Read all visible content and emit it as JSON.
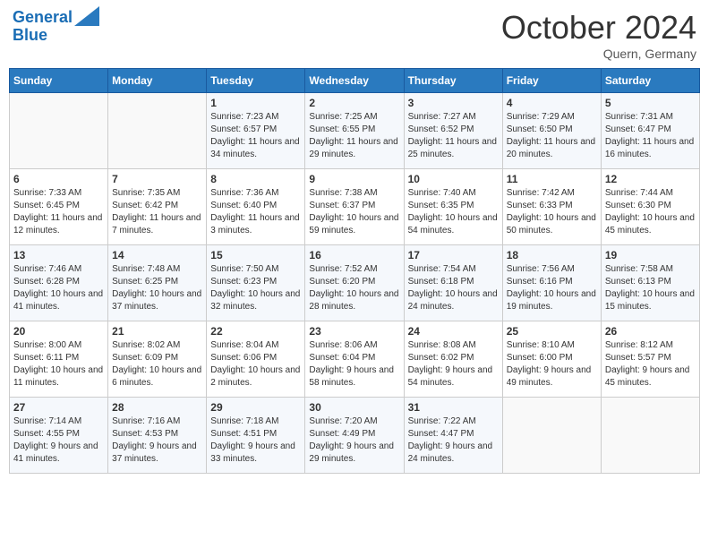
{
  "header": {
    "logo_line1": "General",
    "logo_line2": "Blue",
    "month": "October 2024",
    "location": "Quern, Germany"
  },
  "weekdays": [
    "Sunday",
    "Monday",
    "Tuesday",
    "Wednesday",
    "Thursday",
    "Friday",
    "Saturday"
  ],
  "weeks": [
    [
      {
        "day": "",
        "info": ""
      },
      {
        "day": "",
        "info": ""
      },
      {
        "day": "1",
        "info": "Sunrise: 7:23 AM\nSunset: 6:57 PM\nDaylight: 11 hours and 34 minutes."
      },
      {
        "day": "2",
        "info": "Sunrise: 7:25 AM\nSunset: 6:55 PM\nDaylight: 11 hours and 29 minutes."
      },
      {
        "day": "3",
        "info": "Sunrise: 7:27 AM\nSunset: 6:52 PM\nDaylight: 11 hours and 25 minutes."
      },
      {
        "day": "4",
        "info": "Sunrise: 7:29 AM\nSunset: 6:50 PM\nDaylight: 11 hours and 20 minutes."
      },
      {
        "day": "5",
        "info": "Sunrise: 7:31 AM\nSunset: 6:47 PM\nDaylight: 11 hours and 16 minutes."
      }
    ],
    [
      {
        "day": "6",
        "info": "Sunrise: 7:33 AM\nSunset: 6:45 PM\nDaylight: 11 hours and 12 minutes."
      },
      {
        "day": "7",
        "info": "Sunrise: 7:35 AM\nSunset: 6:42 PM\nDaylight: 11 hours and 7 minutes."
      },
      {
        "day": "8",
        "info": "Sunrise: 7:36 AM\nSunset: 6:40 PM\nDaylight: 11 hours and 3 minutes."
      },
      {
        "day": "9",
        "info": "Sunrise: 7:38 AM\nSunset: 6:37 PM\nDaylight: 10 hours and 59 minutes."
      },
      {
        "day": "10",
        "info": "Sunrise: 7:40 AM\nSunset: 6:35 PM\nDaylight: 10 hours and 54 minutes."
      },
      {
        "day": "11",
        "info": "Sunrise: 7:42 AM\nSunset: 6:33 PM\nDaylight: 10 hours and 50 minutes."
      },
      {
        "day": "12",
        "info": "Sunrise: 7:44 AM\nSunset: 6:30 PM\nDaylight: 10 hours and 45 minutes."
      }
    ],
    [
      {
        "day": "13",
        "info": "Sunrise: 7:46 AM\nSunset: 6:28 PM\nDaylight: 10 hours and 41 minutes."
      },
      {
        "day": "14",
        "info": "Sunrise: 7:48 AM\nSunset: 6:25 PM\nDaylight: 10 hours and 37 minutes."
      },
      {
        "day": "15",
        "info": "Sunrise: 7:50 AM\nSunset: 6:23 PM\nDaylight: 10 hours and 32 minutes."
      },
      {
        "day": "16",
        "info": "Sunrise: 7:52 AM\nSunset: 6:20 PM\nDaylight: 10 hours and 28 minutes."
      },
      {
        "day": "17",
        "info": "Sunrise: 7:54 AM\nSunset: 6:18 PM\nDaylight: 10 hours and 24 minutes."
      },
      {
        "day": "18",
        "info": "Sunrise: 7:56 AM\nSunset: 6:16 PM\nDaylight: 10 hours and 19 minutes."
      },
      {
        "day": "19",
        "info": "Sunrise: 7:58 AM\nSunset: 6:13 PM\nDaylight: 10 hours and 15 minutes."
      }
    ],
    [
      {
        "day": "20",
        "info": "Sunrise: 8:00 AM\nSunset: 6:11 PM\nDaylight: 10 hours and 11 minutes."
      },
      {
        "day": "21",
        "info": "Sunrise: 8:02 AM\nSunset: 6:09 PM\nDaylight: 10 hours and 6 minutes."
      },
      {
        "day": "22",
        "info": "Sunrise: 8:04 AM\nSunset: 6:06 PM\nDaylight: 10 hours and 2 minutes."
      },
      {
        "day": "23",
        "info": "Sunrise: 8:06 AM\nSunset: 6:04 PM\nDaylight: 9 hours and 58 minutes."
      },
      {
        "day": "24",
        "info": "Sunrise: 8:08 AM\nSunset: 6:02 PM\nDaylight: 9 hours and 54 minutes."
      },
      {
        "day": "25",
        "info": "Sunrise: 8:10 AM\nSunset: 6:00 PM\nDaylight: 9 hours and 49 minutes."
      },
      {
        "day": "26",
        "info": "Sunrise: 8:12 AM\nSunset: 5:57 PM\nDaylight: 9 hours and 45 minutes."
      }
    ],
    [
      {
        "day": "27",
        "info": "Sunrise: 7:14 AM\nSunset: 4:55 PM\nDaylight: 9 hours and 41 minutes."
      },
      {
        "day": "28",
        "info": "Sunrise: 7:16 AM\nSunset: 4:53 PM\nDaylight: 9 hours and 37 minutes."
      },
      {
        "day": "29",
        "info": "Sunrise: 7:18 AM\nSunset: 4:51 PM\nDaylight: 9 hours and 33 minutes."
      },
      {
        "day": "30",
        "info": "Sunrise: 7:20 AM\nSunset: 4:49 PM\nDaylight: 9 hours and 29 minutes."
      },
      {
        "day": "31",
        "info": "Sunrise: 7:22 AM\nSunset: 4:47 PM\nDaylight: 9 hours and 24 minutes."
      },
      {
        "day": "",
        "info": ""
      },
      {
        "day": "",
        "info": ""
      }
    ]
  ]
}
